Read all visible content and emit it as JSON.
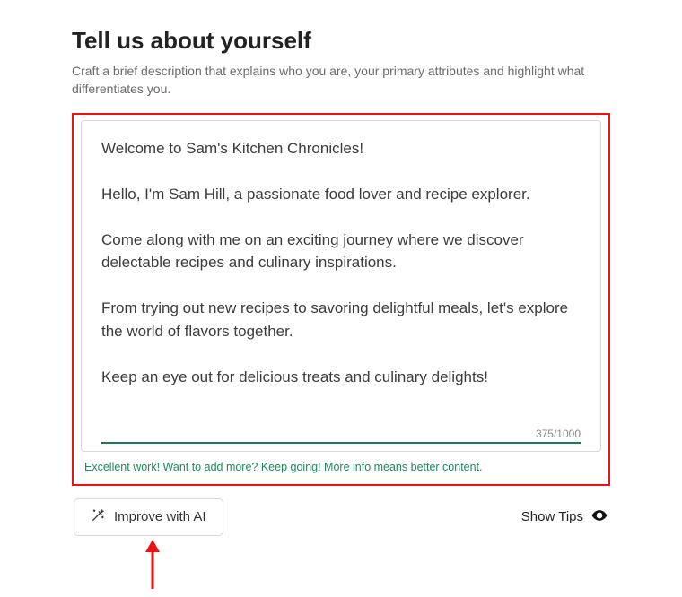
{
  "header": {
    "title": "Tell us about yourself",
    "subtitle": "Craft a brief description that explains who you are, your primary attributes and highlight what differentiates you."
  },
  "bio": {
    "text": "Welcome to Sam's Kitchen Chronicles!\n\nHello, I'm Sam Hill, a passionate food lover and recipe explorer.\n\nCome along with me on an exciting journey where we discover delectable recipes and culinary inspirations.\n\nFrom trying out new recipes to savoring delightful meals, let's explore the world of flavors together.\n\nKeep an eye out for delicious treats and culinary delights!",
    "char_count": "375/1000",
    "hint": "Excellent work! Want to add more? Keep going! More info means better content."
  },
  "toolbar": {
    "improve_label": "Improve with AI",
    "show_tips_label": "Show Tips"
  },
  "icons": {
    "magic": "magic-wand-icon",
    "eye": "eye-icon"
  },
  "colors": {
    "accent_green": "#1f8a5a",
    "highlight_red": "#e11"
  }
}
